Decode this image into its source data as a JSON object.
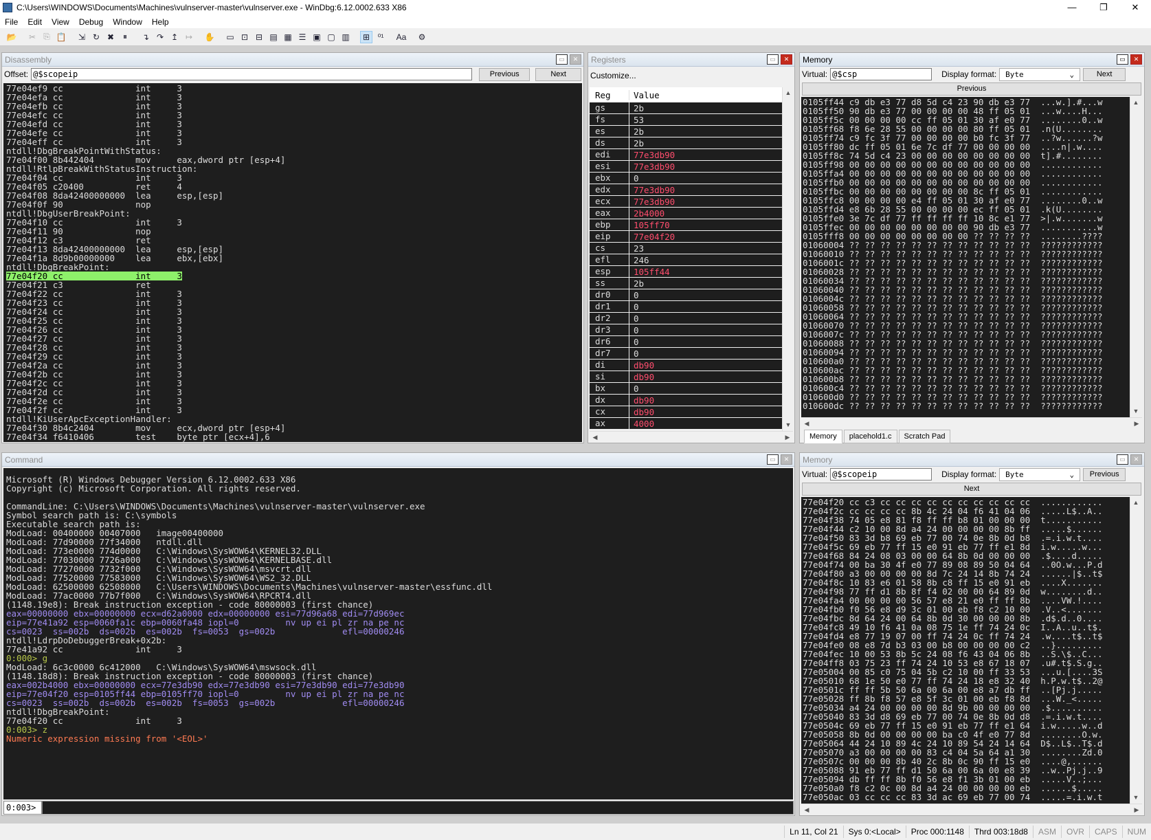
{
  "window": {
    "title": "C:\\Users\\WINDOWS\\Documents\\Machines\\vulnserver-master\\vulnserver.exe - WinDbg:6.12.0002.633 X86",
    "minimize": "—",
    "maximize": "❐",
    "close": "✕"
  },
  "menu": [
    "File",
    "Edit",
    "View",
    "Debug",
    "Window",
    "Help"
  ],
  "toolbar": [
    {
      "icon": "open-icon",
      "g": "📂"
    },
    {
      "icon": "sep"
    },
    {
      "icon": "cut-icon",
      "g": "✂",
      "dis": true
    },
    {
      "icon": "copy-icon",
      "g": "⎘",
      "dis": true
    },
    {
      "icon": "paste-icon",
      "g": "📋",
      "dis": true
    },
    {
      "icon": "sep"
    },
    {
      "icon": "go-icon",
      "g": "⇲"
    },
    {
      "icon": "restart-icon",
      "g": "↻"
    },
    {
      "icon": "stop-debugging-icon",
      "g": "✖"
    },
    {
      "icon": "break-icon",
      "g": "⏸"
    },
    {
      "icon": "sep"
    },
    {
      "icon": "step-into-icon",
      "g": "↴"
    },
    {
      "icon": "step-over-icon",
      "g": "↷"
    },
    {
      "icon": "step-out-icon",
      "g": "↥"
    },
    {
      "icon": "run-to-cursor-icon",
      "g": "↦",
      "dis": true
    },
    {
      "icon": "sep"
    },
    {
      "icon": "hand-icon",
      "g": "✋"
    },
    {
      "icon": "sep"
    },
    {
      "icon": "command-window-icon",
      "g": "▭"
    },
    {
      "icon": "watch-window-icon",
      "g": "⊡"
    },
    {
      "icon": "locals-window-icon",
      "g": "⊟"
    },
    {
      "icon": "registers-window-icon",
      "g": "▤"
    },
    {
      "icon": "memory-window-icon",
      "g": "▦"
    },
    {
      "icon": "call-stack-icon",
      "g": "☰"
    },
    {
      "icon": "disassembly-window-icon",
      "g": "▣"
    },
    {
      "icon": "scratch-pad-icon",
      "g": "▢"
    },
    {
      "icon": "processes-threads-icon",
      "g": "▥"
    },
    {
      "icon": "sep"
    },
    {
      "icon": "source-mode-icon",
      "g": "⊞",
      "on": true
    },
    {
      "icon": "hex-mode-icon",
      "g": "⁰¹"
    },
    {
      "icon": "sep"
    },
    {
      "icon": "font-icon",
      "g": "Aa"
    },
    {
      "icon": "sep"
    },
    {
      "icon": "options-icon",
      "g": "⚙"
    }
  ],
  "disassembly": {
    "title": "Disassembly",
    "offset_label": "Offset:",
    "offset_value": "@$scopeip",
    "previous": "Previous",
    "next": "Next",
    "lines": [
      {
        "a": "77e04ef9",
        "b": "cc",
        "m": "int",
        "o": "3"
      },
      {
        "a": "77e04efa",
        "b": "cc",
        "m": "int",
        "o": "3"
      },
      {
        "a": "77e04efb",
        "b": "cc",
        "m": "int",
        "o": "3"
      },
      {
        "a": "77e04efc",
        "b": "cc",
        "m": "int",
        "o": "3"
      },
      {
        "a": "77e04efd",
        "b": "cc",
        "m": "int",
        "o": "3"
      },
      {
        "a": "77e04efe",
        "b": "cc",
        "m": "int",
        "o": "3"
      },
      {
        "a": "77e04eff",
        "b": "cc",
        "m": "int",
        "o": "3"
      },
      {
        "label": "ntdll!DbgBreakPointWithStatus:"
      },
      {
        "a": "77e04f00",
        "b": "8b442404",
        "m": "mov",
        "o": "eax,dword ptr [esp+4]"
      },
      {
        "label": "ntdll!RtlpBreakWithStatusInstruction:"
      },
      {
        "a": "77e04f04",
        "b": "cc",
        "m": "int",
        "o": "3"
      },
      {
        "a": "77e04f05",
        "b": "c20400",
        "m": "ret",
        "o": "4"
      },
      {
        "a": "77e04f08",
        "b": "8da42400000000",
        "m": "lea",
        "o": "esp,[esp]"
      },
      {
        "a": "77e04f0f",
        "b": "90",
        "m": "nop",
        "o": ""
      },
      {
        "label": "ntdll!DbgUserBreakPoint:"
      },
      {
        "a": "77e04f10",
        "b": "cc",
        "m": "int",
        "o": "3"
      },
      {
        "a": "77e04f11",
        "b": "90",
        "m": "nop",
        "o": ""
      },
      {
        "a": "77e04f12",
        "b": "c3",
        "m": "ret",
        "o": ""
      },
      {
        "a": "77e04f13",
        "b": "8da42400000000",
        "m": "lea",
        "o": "esp,[esp]"
      },
      {
        "a": "77e04f1a",
        "b": "8d9b00000000",
        "m": "lea",
        "o": "ebx,[ebx]"
      },
      {
        "label": "ntdll!DbgBreakPoint:"
      },
      {
        "a": "77e04f20",
        "b": "cc",
        "m": "int",
        "o": "3",
        "current": true
      },
      {
        "a": "77e04f21",
        "b": "c3",
        "m": "ret",
        "o": ""
      },
      {
        "a": "77e04f22",
        "b": "cc",
        "m": "int",
        "o": "3"
      },
      {
        "a": "77e04f23",
        "b": "cc",
        "m": "int",
        "o": "3"
      },
      {
        "a": "77e04f24",
        "b": "cc",
        "m": "int",
        "o": "3"
      },
      {
        "a": "77e04f25",
        "b": "cc",
        "m": "int",
        "o": "3"
      },
      {
        "a": "77e04f26",
        "b": "cc",
        "m": "int",
        "o": "3"
      },
      {
        "a": "77e04f27",
        "b": "cc",
        "m": "int",
        "o": "3"
      },
      {
        "a": "77e04f28",
        "b": "cc",
        "m": "int",
        "o": "3"
      },
      {
        "a": "77e04f29",
        "b": "cc",
        "m": "int",
        "o": "3"
      },
      {
        "a": "77e04f2a",
        "b": "cc",
        "m": "int",
        "o": "3"
      },
      {
        "a": "77e04f2b",
        "b": "cc",
        "m": "int",
        "o": "3"
      },
      {
        "a": "77e04f2c",
        "b": "cc",
        "m": "int",
        "o": "3"
      },
      {
        "a": "77e04f2d",
        "b": "cc",
        "m": "int",
        "o": "3"
      },
      {
        "a": "77e04f2e",
        "b": "cc",
        "m": "int",
        "o": "3"
      },
      {
        "a": "77e04f2f",
        "b": "cc",
        "m": "int",
        "o": "3"
      },
      {
        "label": "ntdll!KiUserApcExceptionHandler:"
      },
      {
        "a": "77e04f30",
        "b": "8b4c2404",
        "m": "mov",
        "o": "ecx,dword ptr [esp+4]"
      },
      {
        "a": "77e04f34",
        "b": "f6410406",
        "m": "test",
        "o": "byte ptr [ecx+4],6"
      }
    ],
    "highlight_color": "#8ef06a"
  },
  "registers": {
    "title": "Registers",
    "customize": "Customize...",
    "col_reg": "Reg",
    "col_value": "Value",
    "changed_color": "#ff4d6d",
    "rows": [
      [
        "gs",
        "2b",
        0
      ],
      [
        "fs",
        "53",
        0
      ],
      [
        "es",
        "2b",
        0
      ],
      [
        "ds",
        "2b",
        0
      ],
      [
        "edi",
        "77e3db90",
        1
      ],
      [
        "esi",
        "77e3db90",
        1
      ],
      [
        "ebx",
        "0",
        0
      ],
      [
        "edx",
        "77e3db90",
        1
      ],
      [
        "ecx",
        "77e3db90",
        1
      ],
      [
        "eax",
        "2b4000",
        1
      ],
      [
        "ebp",
        "105ff70",
        1
      ],
      [
        "eip",
        "77e04f20",
        1
      ],
      [
        "cs",
        "23",
        0
      ],
      [
        "efl",
        "246",
        0
      ],
      [
        "esp",
        "105ff44",
        1
      ],
      [
        "ss",
        "2b",
        0
      ],
      [
        "dr0",
        "0",
        0
      ],
      [
        "dr1",
        "0",
        0
      ],
      [
        "dr2",
        "0",
        0
      ],
      [
        "dr3",
        "0",
        0
      ],
      [
        "dr6",
        "0",
        0
      ],
      [
        "dr7",
        "0",
        0
      ],
      [
        "di",
        "db90",
        1
      ],
      [
        "si",
        "db90",
        1
      ],
      [
        "bx",
        "0",
        0
      ],
      [
        "dx",
        "db90",
        1
      ],
      [
        "cx",
        "db90",
        1
      ],
      [
        "ax",
        "4000",
        1
      ]
    ]
  },
  "memory_top": {
    "title": "Memory",
    "virtual_label": "Virtual:",
    "virtual_value": "@$csp",
    "format_label": "Display format:",
    "format_value": "Byte",
    "next": "Next",
    "previous": "Previous",
    "tabs": [
      "Memory",
      "placehold1.c",
      "Scratch Pad"
    ],
    "rows": [
      [
        "0105ff44",
        "c9 db e3 77 d8 5d c4 23 90 db e3 77",
        "...w.].#...w"
      ],
      [
        "0105ff50",
        "90 db e3 77 00 00 00 00 48 ff 05 01",
        "...w....H..."
      ],
      [
        "0105ff5c",
        "00 00 00 00 cc ff 05 01 30 af e0 77",
        "........0..w"
      ],
      [
        "0105ff68",
        "f8 6e 28 55 00 00 00 00 80 ff 05 01",
        ".n(U........"
      ],
      [
        "0105ff74",
        "c9 fc 3f 77 00 00 00 00 b0 fc 3f 77",
        "..?w......?w"
      ],
      [
        "0105ff80",
        "dc ff 05 01 6e 7c df 77 00 00 00 00",
        "....n|.w...."
      ],
      [
        "0105ff8c",
        "74 5d c4 23 00 00 00 00 00 00 00 00",
        "t].#........"
      ],
      [
        "0105ff98",
        "00 00 00 00 00 00 00 00 00 00 00 00",
        "............"
      ],
      [
        "0105ffa4",
        "00 00 00 00 00 00 00 00 00 00 00 00",
        "............"
      ],
      [
        "0105ffb0",
        "00 00 00 00 00 00 00 00 00 00 00 00",
        "............"
      ],
      [
        "0105ffbc",
        "00 00 00 00 00 00 00 00 8c ff 05 01",
        "............"
      ],
      [
        "0105ffc8",
        "00 00 00 00 e4 ff 05 01 30 af e0 77",
        "........0..w"
      ],
      [
        "0105ffd4",
        "e8 6b 28 55 00 00 00 00 ec ff 05 01",
        ".k(U........"
      ],
      [
        "0105ffe0",
        "3e 7c df 77 ff ff ff ff 10 8c e1 77",
        ">|.w.......w"
      ],
      [
        "0105ffec",
        "00 00 00 00 00 00 00 00 90 db e3 77",
        "...........w"
      ],
      [
        "0105fff8",
        "00 00 00 00 00 00 00 00 ?? ?? ?? ??",
        "........????"
      ],
      [
        "01060004",
        "?? ?? ?? ?? ?? ?? ?? ?? ?? ?? ?? ??",
        "????????????"
      ],
      [
        "01060010",
        "?? ?? ?? ?? ?? ?? ?? ?? ?? ?? ?? ??",
        "????????????"
      ],
      [
        "0106001c",
        "?? ?? ?? ?? ?? ?? ?? ?? ?? ?? ?? ??",
        "????????????"
      ],
      [
        "01060028",
        "?? ?? ?? ?? ?? ?? ?? ?? ?? ?? ?? ??",
        "????????????"
      ],
      [
        "01060034",
        "?? ?? ?? ?? ?? ?? ?? ?? ?? ?? ?? ??",
        "????????????"
      ],
      [
        "01060040",
        "?? ?? ?? ?? ?? ?? ?? ?? ?? ?? ?? ??",
        "????????????"
      ],
      [
        "0106004c",
        "?? ?? ?? ?? ?? ?? ?? ?? ?? ?? ?? ??",
        "????????????"
      ],
      [
        "01060058",
        "?? ?? ?? ?? ?? ?? ?? ?? ?? ?? ?? ??",
        "????????????"
      ],
      [
        "01060064",
        "?? ?? ?? ?? ?? ?? ?? ?? ?? ?? ?? ??",
        "????????????"
      ],
      [
        "01060070",
        "?? ?? ?? ?? ?? ?? ?? ?? ?? ?? ?? ??",
        "????????????"
      ],
      [
        "0106007c",
        "?? ?? ?? ?? ?? ?? ?? ?? ?? ?? ?? ??",
        "????????????"
      ],
      [
        "01060088",
        "?? ?? ?? ?? ?? ?? ?? ?? ?? ?? ?? ??",
        "????????????"
      ],
      [
        "01060094",
        "?? ?? ?? ?? ?? ?? ?? ?? ?? ?? ?? ??",
        "????????????"
      ],
      [
        "010600a0",
        "?? ?? ?? ?? ?? ?? ?? ?? ?? ?? ?? ??",
        "????????????"
      ],
      [
        "010600ac",
        "?? ?? ?? ?? ?? ?? ?? ?? ?? ?? ?? ??",
        "????????????"
      ],
      [
        "010600b8",
        "?? ?? ?? ?? ?? ?? ?? ?? ?? ?? ?? ??",
        "????????????"
      ],
      [
        "010600c4",
        "?? ?? ?? ?? ?? ?? ?? ?? ?? ?? ?? ??",
        "????????????"
      ],
      [
        "010600d0",
        "?? ?? ?? ?? ?? ?? ?? ?? ?? ?? ?? ??",
        "????????????"
      ],
      [
        "010600dc",
        "?? ?? ?? ?? ?? ?? ?? ?? ?? ?? ?? ??",
        "????????????"
      ]
    ]
  },
  "memory_bottom": {
    "title": "Memory",
    "virtual_label": "Virtual:",
    "virtual_value": "@$scopeip",
    "format_label": "Display format:",
    "format_value": "Byte",
    "previous": "Previous",
    "next": "Next",
    "rows": [
      [
        "77e04f20",
        "cc c3 cc cc cc cc cc cc cc cc cc cc",
        "............"
      ],
      [
        "77e04f2c",
        "cc cc cc cc 8b 4c 24 04 f6 41 04 06",
        ".....L$..A.."
      ],
      [
        "77e04f38",
        "74 05 e8 81 f8 ff ff b8 01 00 00 00",
        "t..........."
      ],
      [
        "77e04f44",
        "c2 10 00 8d a4 24 00 00 00 00 8b ff",
        ".....$......"
      ],
      [
        "77e04f50",
        "83 3d b8 69 eb 77 00 74 0e 8b 0d b8",
        ".=.i.w.t...."
      ],
      [
        "77e04f5c",
        "69 eb 77 ff 15 e0 91 eb 77 ff e1 8d",
        "i.w.....w..."
      ],
      [
        "77e04f68",
        "84 24 08 03 00 00 64 8b 0d 00 00 00",
        ".$....d....."
      ],
      [
        "77e04f74",
        "00 ba 30 4f e0 77 89 08 89 50 04 64",
        "..0O.w...P.d"
      ],
      [
        "77e04f80",
        "a3 00 00 00 00 8d 7c 24 14 8b 74 24",
        "......|$..t$"
      ],
      [
        "77e04f8c",
        "10 83 e6 01 58 8b c8 ff 15 e0 91 eb",
        "....X......."
      ],
      [
        "77e04f98",
        "77 ff d1 8b 8f f4 02 00 00 64 89 0d",
        "w........d.."
      ],
      [
        "77e04fa4",
        "00 00 00 00 56 57 e8 21 e0 ff ff 8b",
        "....VW.!...."
      ],
      [
        "77e04fb0",
        "f0 56 e8 d9 3c 01 00 eb f8 c2 10 00",
        ".V..<......."
      ],
      [
        "77e04fbc",
        "8d 64 24 00 64 8b 0d 30 00 00 00 8b",
        ".d$.d..0...."
      ],
      [
        "77e04fc8",
        "49 10 f6 41 0a 08 75 1e ff 74 24 0c",
        "I..A..u..t$."
      ],
      [
        "77e04fd4",
        "e8 77 19 07 00 ff 74 24 0c ff 74 24",
        ".w....t$..t$"
      ],
      [
        "77e04fe0",
        "08 e8 7d b3 03 00 b8 00 00 00 00 c2",
        "..}........."
      ],
      [
        "77e04fec",
        "10 00 53 8b 5c 24 08 f6 43 04 06 8b",
        "..S.\\$..C..."
      ],
      [
        "77e04ff8",
        "03 75 23 ff 74 24 10 53 e8 67 18 07",
        ".u#.t$.S.g.."
      ],
      [
        "77e05004",
        "00 85 c0 75 04 5b c2 10 00 ff 33 53",
        "...u.[....3S"
      ],
      [
        "77e05010",
        "68 1e 50 e0 77 ff 74 24 18 e8 32 40",
        "h.P.w.t$..2@"
      ],
      [
        "77e0501c",
        "ff ff 5b 50 6a 00 6a 00 e8 a7 db ff",
        "..[Pj.j....."
      ],
      [
        "77e05028",
        "ff 8b f8 57 e8 5f 3c 01 00 eb f8 8d",
        "...W._<....."
      ],
      [
        "77e05034",
        "a4 24 00 00 00 00 8d 9b 00 00 00 00",
        ".$.........."
      ],
      [
        "77e05040",
        "83 3d d8 69 eb 77 00 74 0e 8b 0d d8",
        ".=.i.w.t...."
      ],
      [
        "77e0504c",
        "69 eb 77 ff 15 e0 91 eb 77 ff e1 64",
        "i.w.....w..d"
      ],
      [
        "77e05058",
        "8b 0d 00 00 00 00 ba c0 4f e0 77 8d",
        "........O.w."
      ],
      [
        "77e05064",
        "44 24 10 89 4c 24 10 89 54 24 14 64",
        "D$..L$..T$.d"
      ],
      [
        "77e05070",
        "a3 00 00 00 00 83 c4 04 5a 64 a1 30",
        "........Zd.0"
      ],
      [
        "77e0507c",
        "00 00 00 8b 40 2c 8b 0c 90 ff 15 e0",
        "....@,......"
      ],
      [
        "77e05088",
        "91 eb 77 ff d1 50 6a 00 6a 00 e8 39",
        "..w..Pj.j..9"
      ],
      [
        "77e05094",
        "db ff ff 8b f0 56 e8 f1 3b 01 00 eb",
        ".....V..;..."
      ],
      [
        "77e050a0",
        "f8 c2 0c 00 8d a4 24 00 00 00 00 eb",
        "......$....."
      ],
      [
        "77e050ac",
        "03 cc cc cc 83 3d ac 69 eb 77 00 74",
        ".....=.i.w.t"
      ]
    ]
  },
  "command": {
    "title": "Command",
    "prompt": "0:003>",
    "input_value": "",
    "colors": {
      "reg": "#a18cf2",
      "prompt": "#b9c94a",
      "err": "#ff7a52"
    },
    "lines": [
      {
        "t": "Microsoft (R) Windows Debugger Version 6.12.0002.633 X86"
      },
      {
        "t": "Copyright (c) Microsoft Corporation. All rights reserved."
      },
      {
        "t": ""
      },
      {
        "t": "CommandLine: C:\\Users\\WINDOWS\\Documents\\Machines\\vulnserver-master\\vulnserver.exe"
      },
      {
        "t": "Symbol search path is: C:\\symbols"
      },
      {
        "t": "Executable search path is: "
      },
      {
        "t": "ModLoad: 00400000 00407000   image00400000"
      },
      {
        "t": "ModLoad: 77d90000 77f34000   ntdll.dll"
      },
      {
        "t": "ModLoad: 773e0000 774d0000   C:\\Windows\\SysWOW64\\KERNEL32.DLL"
      },
      {
        "t": "ModLoad: 77030000 7726a000   C:\\Windows\\SysWOW64\\KERNELBASE.dll"
      },
      {
        "t": "ModLoad: 77270000 7732f000   C:\\Windows\\SysWOW64\\msvcrt.dll"
      },
      {
        "t": "ModLoad: 77520000 77583000   C:\\Windows\\SysWOW64\\WS2_32.DLL"
      },
      {
        "t": "ModLoad: 62500000 62508000   C:\\Users\\WINDOWS\\Documents\\Machines\\vulnserver-master\\essfunc.dll"
      },
      {
        "t": "ModLoad: 77ac0000 77b7f000   C:\\Windows\\SysWOW64\\RPCRT4.dll"
      },
      {
        "t": "(1148.19e8): Break instruction exception - code 80000003 (first chance)"
      },
      {
        "t": "eax=00000000 ebx=00000000 ecx=d62a0000 edx=00000000 esi=77d96a68 edi=77d969ec",
        "c": "reg"
      },
      {
        "t": "eip=77e41a92 esp=0060fa1c ebp=0060fa48 iopl=0         nv up ei pl zr na pe nc",
        "c": "reg"
      },
      {
        "t": "cs=0023  ss=002b  ds=002b  es=002b  fs=0053  gs=002b             efl=00000246",
        "c": "reg"
      },
      {
        "t": "ntdll!LdrpDoDebuggerBreak+0x2b:"
      },
      {
        "t": "77e41a92 cc              int     3"
      },
      {
        "t": "0:000> g",
        "c": "prompt"
      },
      {
        "t": "ModLoad: 6c3c0000 6c412000   C:\\Windows\\SysWOW64\\mswsock.dll"
      },
      {
        "t": "(1148.18d8): Break instruction exception - code 80000003 (first chance)"
      },
      {
        "t": "eax=002b4000 ebx=00000000 ecx=77e3db90 edx=77e3db90 esi=77e3db90 edi=77e3db90",
        "c": "reg"
      },
      {
        "t": "eip=77e04f20 esp=0105ff44 ebp=0105ff70 iopl=0         nv up ei pl zr na pe nc",
        "c": "reg"
      },
      {
        "t": "cs=0023  ss=002b  ds=002b  es=002b  fs=0053  gs=002b             efl=00000246",
        "c": "reg"
      },
      {
        "t": "ntdll!DbgBreakPoint:"
      },
      {
        "t": "77e04f20 cc              int     3"
      },
      {
        "t": "0:003> z",
        "c": "prompt"
      },
      {
        "t": "Numeric expression missing from '<EOL>'",
        "c": "err"
      }
    ]
  },
  "status": {
    "items": [
      {
        "t": "Ln 11, Col 21"
      },
      {
        "t": "Sys 0:<Local>"
      },
      {
        "t": "Proc 000:1148"
      },
      {
        "t": "Thrd 003:18d8"
      },
      {
        "t": "ASM",
        "off": true
      },
      {
        "t": "OVR",
        "off": true
      },
      {
        "t": "CAPS",
        "off": true
      },
      {
        "t": "NUM",
        "off": true
      }
    ]
  }
}
